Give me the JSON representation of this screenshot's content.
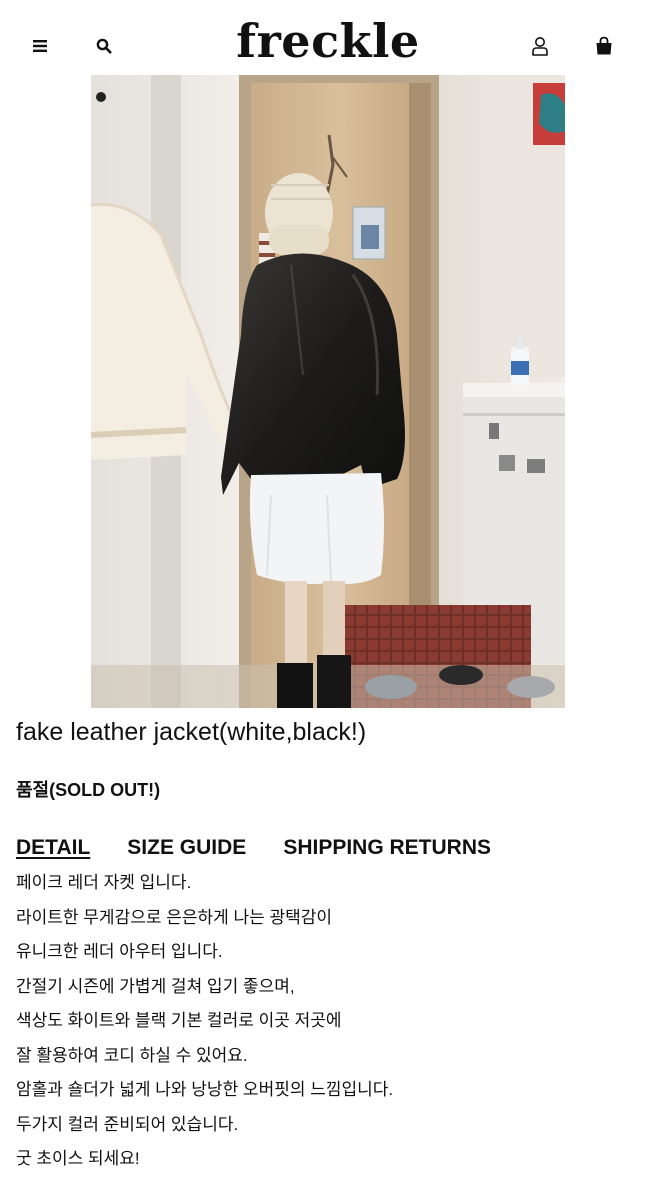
{
  "header": {
    "logo": "freckle",
    "icons": {
      "menu": "hamburger-menu-icon",
      "search": "search-icon",
      "account": "user-account-icon",
      "cart": "shopping-bag-icon"
    }
  },
  "product": {
    "title": "fake leather jacket(white,black!)",
    "status": "품절(SOLD OUT!)"
  },
  "tabs": [
    {
      "label": "DETAIL",
      "active": true
    },
    {
      "label": "SIZE GUIDE",
      "active": false
    },
    {
      "label": "SHIPPING RETURNS",
      "active": false
    }
  ],
  "description": [
    "페이크 레더 자켓 입니다.",
    "라이트한 무게감으로 은은하게 나는 광택감이",
    "유니크한 레더  아우터 입니다.",
    "간절기 시즌에 가볍게 걸쳐 입기 좋으며,",
    "색상도 화이트와 블랙 기본 컬러로 이곳 저곳에",
    "잘 활용하여 코디 하실 수 있어요.",
    "암홀과 숄더가 넓게 나와 낭낭한 오버핏의 느낌입니다.",
    "두가지 컬러 준비되어 있습니다.",
    "굿 초이스 되세요!"
  ]
}
